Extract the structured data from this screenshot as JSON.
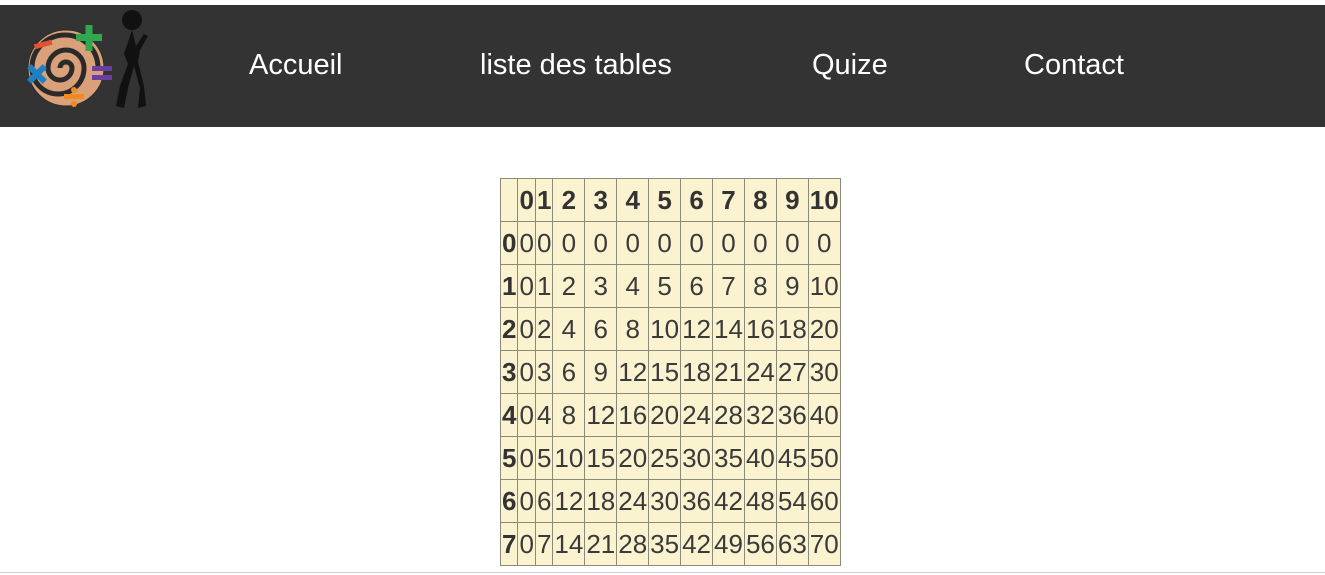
{
  "nav": {
    "links": [
      "Accueil",
      "liste des tables",
      "Quize",
      "Contact"
    ]
  },
  "table": {
    "columns": [
      "",
      "0",
      "1",
      "2",
      "3",
      "4",
      "5",
      "6",
      "7",
      "8",
      "9",
      "10"
    ],
    "rows": [
      {
        "label": "0",
        "cells": [
          "0",
          "0",
          "0",
          "0",
          "0",
          "0",
          "0",
          "0",
          "0",
          "0",
          "0"
        ]
      },
      {
        "label": "1",
        "cells": [
          "0",
          "1",
          "2",
          "3",
          "4",
          "5",
          "6",
          "7",
          "8",
          "9",
          "10"
        ]
      },
      {
        "label": "2",
        "cells": [
          "0",
          "2",
          "4",
          "6",
          "8",
          "10",
          "12",
          "14",
          "16",
          "18",
          "20"
        ]
      },
      {
        "label": "3",
        "cells": [
          "0",
          "3",
          "6",
          "9",
          "12",
          "15",
          "18",
          "21",
          "24",
          "27",
          "30"
        ]
      },
      {
        "label": "4",
        "cells": [
          "0",
          "4",
          "8",
          "12",
          "16",
          "20",
          "24",
          "28",
          "32",
          "36",
          "40"
        ]
      },
      {
        "label": "5",
        "cells": [
          "0",
          "5",
          "10",
          "15",
          "20",
          "25",
          "30",
          "35",
          "40",
          "45",
          "50"
        ]
      },
      {
        "label": "6",
        "cells": [
          "0",
          "6",
          "12",
          "18",
          "24",
          "30",
          "36",
          "42",
          "48",
          "54",
          "60"
        ]
      },
      {
        "label": "7",
        "cells": [
          "0",
          "7",
          "14",
          "21",
          "28",
          "35",
          "42",
          "49",
          "56",
          "63",
          "70"
        ]
      }
    ]
  },
  "colors": {
    "navbar": "#333333",
    "table_bg": "#fbf2cf"
  }
}
